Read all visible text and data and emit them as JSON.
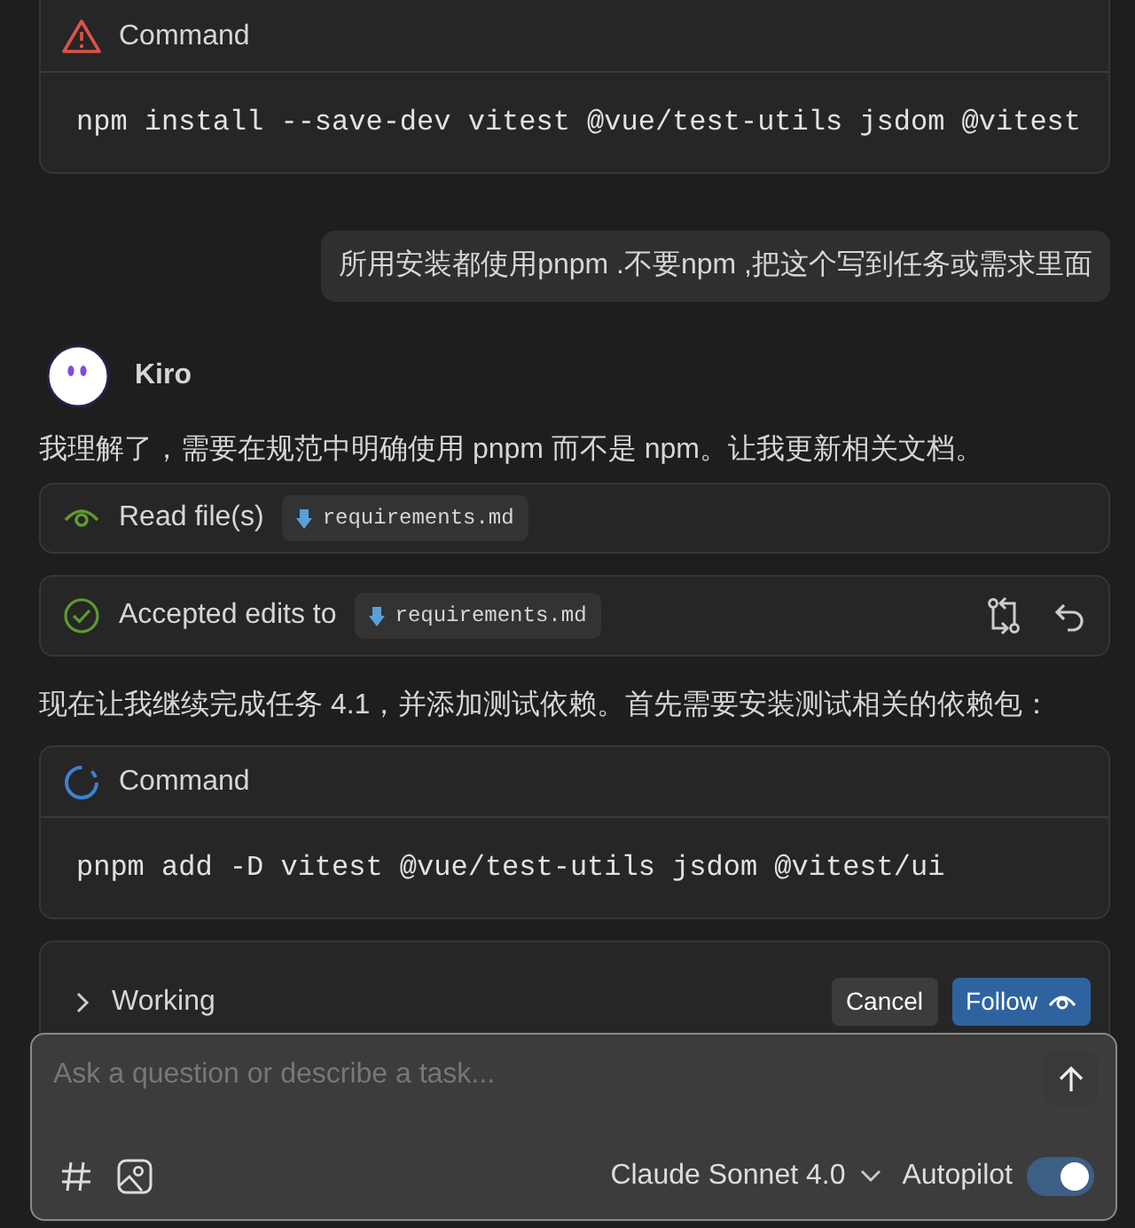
{
  "items": [
    {
      "kind": "command",
      "running": false,
      "title": "Command",
      "code": "npm install --save-dev vitest @vue/test-utils jsdom @vitest"
    },
    {
      "kind": "user",
      "text": "所用安装都使用pnpm .不要npm ,把这个写到任务或需求里面"
    },
    {
      "kind": "agent",
      "name": "Kiro"
    },
    {
      "kind": "text",
      "text": "我理解了，需要在规范中明确使用 pnpm 而不是 npm。让我更新相关文档。"
    },
    {
      "kind": "file",
      "accepted": false,
      "label": "Read file(s)",
      "file": "requirements.md",
      "actions": false
    },
    {
      "kind": "file",
      "accepted": true,
      "label": "Accepted edits to",
      "file": "requirements.md",
      "actions": true
    },
    {
      "kind": "text",
      "text": "现在让我继续完成任务 4.1，并添加测试依赖。首先需要安装测试相关的依赖包："
    },
    {
      "kind": "command",
      "running": true,
      "title": "Command",
      "code": "pnpm add -D vitest @vue/test-utils jsdom @vitest/ui"
    },
    {
      "kind": "working",
      "label": "Working",
      "expanded": false,
      "buttons": [
        {
          "kind": "secondary",
          "label": "Cancel"
        },
        {
          "kind": "primary",
          "label": "Follow"
        }
      ]
    }
  ],
  "composer": {
    "placeholder": "Ask a question or describe a task...",
    "model": "Claude Sonnet 4.0",
    "autopilot": {
      "label": "Autopilot",
      "on": true
    }
  }
}
